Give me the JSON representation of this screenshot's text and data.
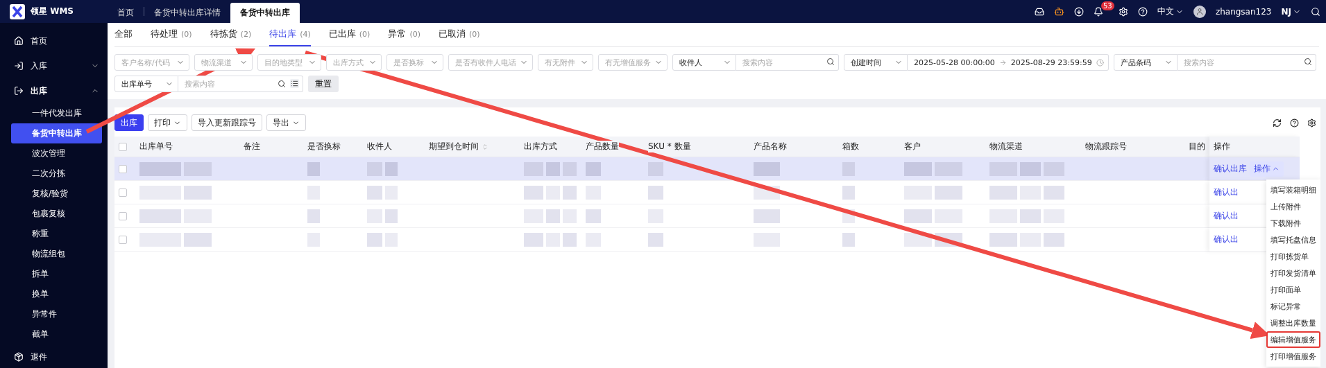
{
  "brand": {
    "name": "领星 WMS"
  },
  "page_tabs": [
    {
      "label": "首页",
      "selected": false
    },
    {
      "label": "备货中转出库详情",
      "selected": false
    },
    {
      "label": "备货中转出库",
      "selected": true
    }
  ],
  "header": {
    "notifications": "53",
    "language": "中文",
    "user": "zhangsan123",
    "warehouse": "NJ"
  },
  "sidebar": {
    "items": [
      {
        "label": "首页",
        "expanded": false
      },
      {
        "label": "入库",
        "expanded": false
      },
      {
        "label": "出库",
        "expanded": true,
        "children": [
          {
            "label": "一件代发出库",
            "selected": false
          },
          {
            "label": "备货中转出库",
            "selected": true
          },
          {
            "label": "波次管理",
            "selected": false
          },
          {
            "label": "二次分拣",
            "selected": false
          },
          {
            "label": "复核/验货",
            "selected": false
          },
          {
            "label": "包裹复核",
            "selected": false
          },
          {
            "label": "称重",
            "selected": false
          },
          {
            "label": "物流组包",
            "selected": false
          },
          {
            "label": "拆单",
            "selected": false
          },
          {
            "label": "换单",
            "selected": false
          },
          {
            "label": "异常件",
            "selected": false
          },
          {
            "label": "截单",
            "selected": false
          }
        ]
      },
      {
        "label": "退件",
        "expanded": false
      }
    ]
  },
  "status_tabs": [
    {
      "label": "全部",
      "selected": false
    },
    {
      "label": "待处理",
      "count": "(0)",
      "selected": false
    },
    {
      "label": "待拣货",
      "count": "(2)",
      "selected": false
    },
    {
      "label": "待出库",
      "count": "(4)",
      "selected": true
    },
    {
      "label": "已出库",
      "count": "(0)",
      "selected": false
    },
    {
      "label": "异常",
      "count": "(0)",
      "selected": false
    },
    {
      "label": "已取消",
      "count": "(0)",
      "selected": false
    }
  ],
  "filters": [
    {
      "kind": "select",
      "placeholder": "客户名称/代码"
    },
    {
      "kind": "select",
      "placeholder": "物流渠道"
    },
    {
      "kind": "select",
      "placeholder": "目的地类型"
    },
    {
      "kind": "select",
      "placeholder": "出库方式"
    },
    {
      "kind": "select",
      "placeholder": "是否换标"
    },
    {
      "kind": "select",
      "placeholder": "是否有收件人电话"
    },
    {
      "kind": "select",
      "placeholder": "有无附件"
    },
    {
      "kind": "select",
      "placeholder": "有无增值服务"
    },
    {
      "kind": "search",
      "field": "收件人",
      "placeholder": "搜索内容"
    },
    {
      "kind": "daterange",
      "field": "创建时间",
      "start": "2025-05-28 00:00:00",
      "end": "2025-08-29 23:59:59"
    },
    {
      "kind": "search",
      "field": "产品条码",
      "placeholder": "搜索内容"
    },
    {
      "kind": "search_list",
      "field": "出库单号",
      "placeholder": "搜索内容"
    },
    {
      "kind": "button",
      "label": "重置"
    }
  ],
  "toolbar": [
    {
      "label": "出库",
      "kind": "primary"
    },
    {
      "label": "打印",
      "kind": "dropdown"
    },
    {
      "label": "导入更新跟踪号",
      "kind": "plain"
    },
    {
      "label": "导出",
      "kind": "dropdown"
    }
  ],
  "table": {
    "all_checked": false,
    "columns": [
      {
        "label": "出库单号"
      },
      {
        "label": "备注"
      },
      {
        "label": "是否换标"
      },
      {
        "label": "收件人"
      },
      {
        "label": "期望到仓时间",
        "sortable": true
      },
      {
        "label": "出库方式"
      },
      {
        "label": "产品数量"
      },
      {
        "label": "SKU * 数量"
      },
      {
        "label": "产品名称"
      },
      {
        "label": "箱数"
      },
      {
        "label": "客户"
      },
      {
        "label": "物流渠道"
      },
      {
        "label": "物流跟踪号"
      },
      {
        "label": "目的"
      },
      {
        "label": "操作"
      }
    ],
    "rows": [
      {
        "checked": false,
        "action": "确认出库",
        "hovered": true,
        "menu_button": "操作",
        "menu_open": true
      },
      {
        "checked": false,
        "action": "确认出",
        "hovered": false
      },
      {
        "checked": false,
        "action": "确认出",
        "hovered": false
      },
      {
        "checked": false,
        "action": "确认出",
        "hovered": false
      }
    ]
  },
  "row_menu": [
    {
      "label": "填写装箱明细",
      "annotated": false
    },
    {
      "label": "上传附件",
      "annotated": false
    },
    {
      "label": "下载附件",
      "annotated": false
    },
    {
      "label": "填写托盘信息",
      "annotated": false
    },
    {
      "label": "打印拣货单",
      "annotated": false
    },
    {
      "label": "打印发货清单",
      "annotated": false
    },
    {
      "label": "打印面单",
      "annotated": false
    },
    {
      "label": "标记异常",
      "annotated": false
    },
    {
      "label": "调整出库数量",
      "annotated": false
    },
    {
      "label": "编辑增值服务",
      "annotated": true
    },
    {
      "label": "打印增值服务",
      "annotated": false
    }
  ]
}
